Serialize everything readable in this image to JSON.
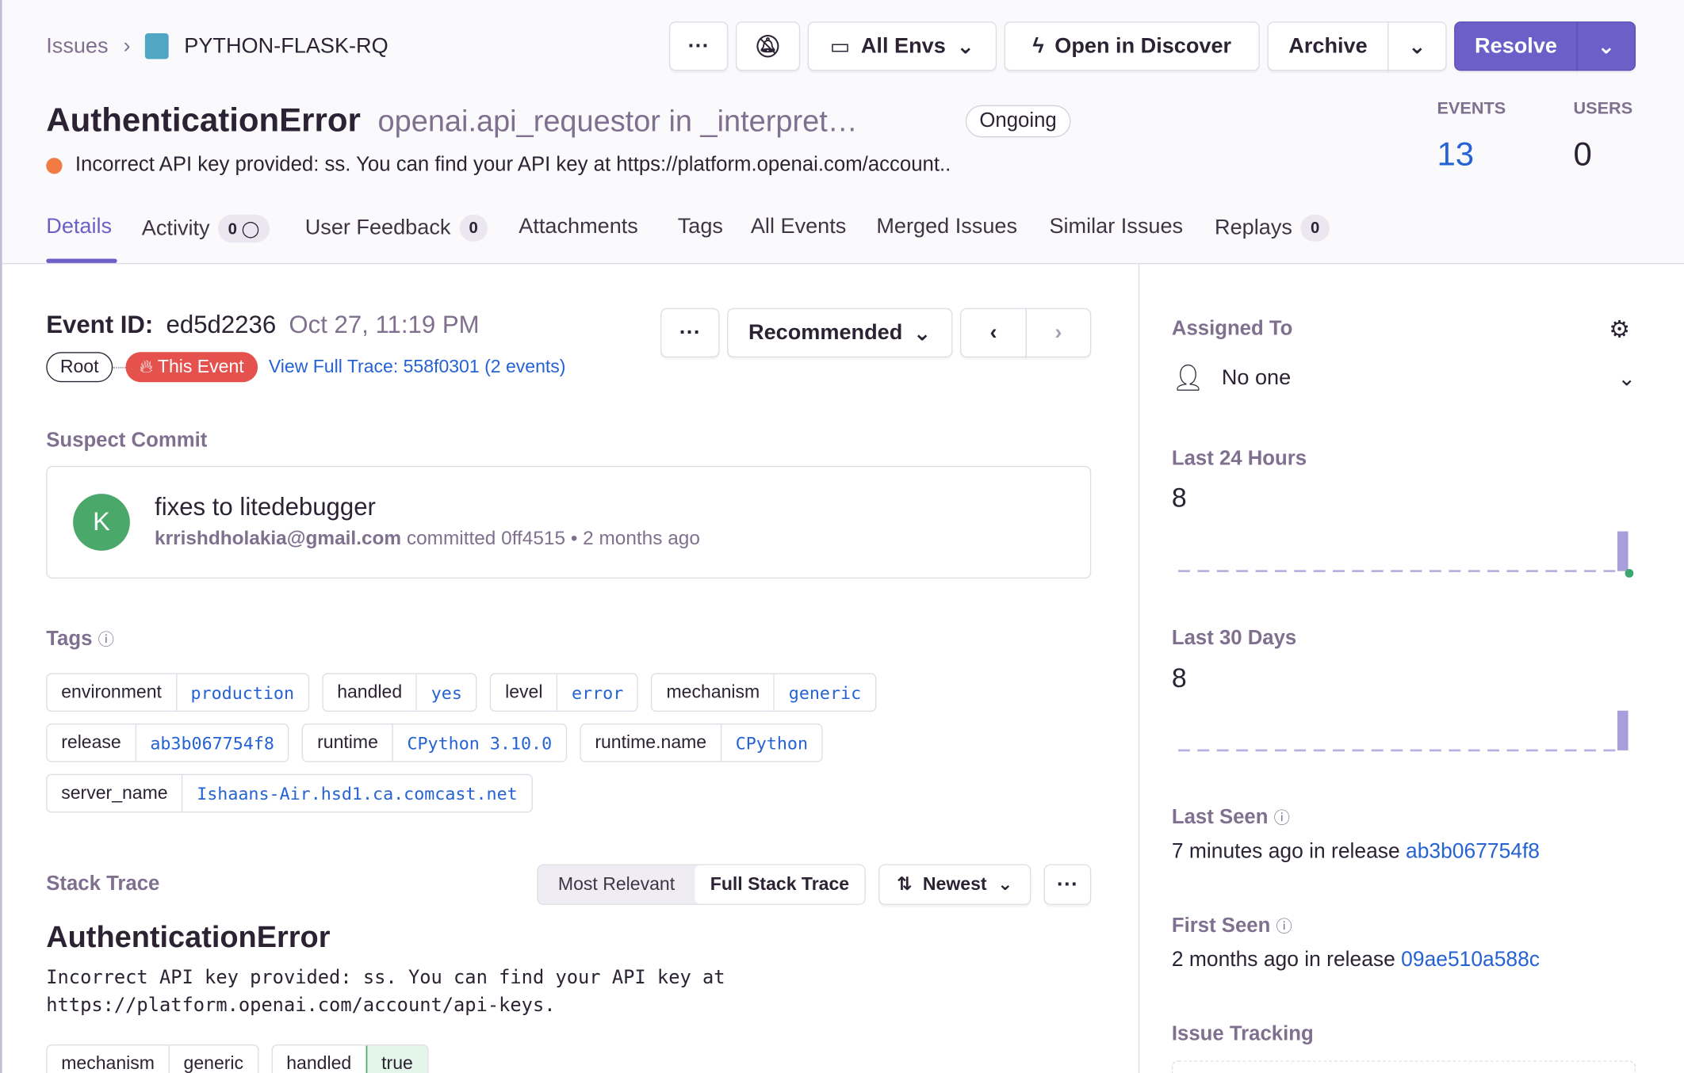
{
  "breadcrumb": {
    "issues": "Issues",
    "project": "PYTHON-FLASK-RQ"
  },
  "toolbar": {
    "more": "···",
    "env": "All Envs",
    "discover": "Open in Discover",
    "archive": "Archive",
    "resolve": "Resolve"
  },
  "issue": {
    "title": "AuthenticationError",
    "culprit": "openai.api_requestor in _interpret…",
    "status": "Ongoing",
    "message": "Incorrect API key provided: ss. You can find your API key at https://platform.openai.com/account.."
  },
  "stats": {
    "events_label": "EVENTS",
    "events": "13",
    "users_label": "USERS",
    "users": "0"
  },
  "tabs": [
    {
      "label": "Details"
    },
    {
      "label": "Activity",
      "count": "0"
    },
    {
      "label": "User Feedback",
      "count": "0"
    },
    {
      "label": "Attachments"
    },
    {
      "label": "Tags"
    },
    {
      "label": "All Events"
    },
    {
      "label": "Merged Issues"
    },
    {
      "label": "Similar Issues"
    },
    {
      "label": "Replays",
      "count": "0"
    }
  ],
  "event": {
    "id_label": "Event ID:",
    "id": "ed5d2236",
    "date": "Oct 27, 11:19 PM",
    "root": "Root",
    "this_event": "This Event",
    "trace": "View Full Trace: 558f0301 (2 events)",
    "sort": "Recommended",
    "more": "···"
  },
  "commit": {
    "heading": "Suspect Commit",
    "avatar": "K",
    "message": "fixes to litedebugger",
    "author": "krrishdholakia@gmail.com",
    "detail": "committed 0ff4515 • 2 months ago"
  },
  "tags": {
    "heading": "Tags",
    "items": [
      {
        "k": "environment",
        "v": "production"
      },
      {
        "k": "handled",
        "v": "yes"
      },
      {
        "k": "level",
        "v": "error"
      },
      {
        "k": "mechanism",
        "v": "generic"
      },
      {
        "k": "release",
        "v": "ab3b067754f8"
      },
      {
        "k": "runtime",
        "v": "CPython 3.10.0"
      },
      {
        "k": "runtime.name",
        "v": "CPython"
      },
      {
        "k": "server_name",
        "v": "Ishaans-Air.hsd1.ca.comcast.net"
      }
    ]
  },
  "stack": {
    "heading": "Stack Trace",
    "most_relevant": "Most Relevant",
    "full": "Full Stack Trace",
    "order": "Newest",
    "more": "···",
    "exception": "AuthenticationError",
    "value": "Incorrect API key provided: ss. You can find your API key at https://platform.openai.com/account/api-keys.",
    "mech_k": "mechanism",
    "mech_v": "generic",
    "handled_k": "handled",
    "handled_v": "true"
  },
  "sidebar": {
    "assigned": "Assigned To",
    "assignee": "No one",
    "last24": "Last 24 Hours",
    "last24_count": "8",
    "last30": "Last 30 Days",
    "last30_count": "8",
    "last_seen": "Last Seen",
    "last_seen_text": "7 minutes ago",
    "in_release": "in release",
    "last_release": "ab3b067754f8",
    "first_seen": "First Seen",
    "first_seen_text": "2 months ago",
    "first_release": "09ae510a588c",
    "issue_tracking": "Issue Tracking"
  },
  "chart_data": [
    {
      "type": "bar",
      "title": "Last 24 Hours",
      "values": [
        0,
        0,
        0,
        0,
        0,
        0,
        0,
        0,
        0,
        0,
        0,
        0,
        0,
        0,
        0,
        0,
        0,
        0,
        0,
        0,
        0,
        0,
        0,
        8
      ]
    },
    {
      "type": "bar",
      "title": "Last 30 Days",
      "values": [
        0,
        0,
        0,
        0,
        0,
        0,
        0,
        0,
        0,
        0,
        0,
        0,
        0,
        0,
        0,
        0,
        0,
        0,
        0,
        0,
        0,
        0,
        0,
        0,
        0,
        0,
        0,
        0,
        0,
        8
      ]
    }
  ],
  "colors": {
    "accent": "#6c5fc7",
    "link": "#2562d4",
    "error": "#f07c44",
    "this_event": "#e5524d"
  }
}
